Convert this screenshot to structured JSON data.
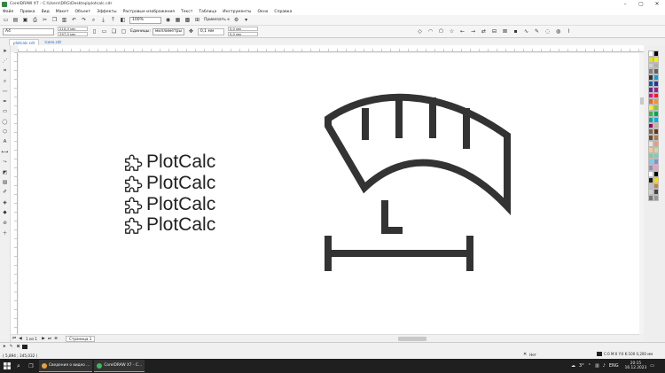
{
  "window": {
    "title": "CorelDRAW X7 - C:\\Users\\DRG\\Desktop\\plotcalc.cdr",
    "controls": {
      "minimize": "–",
      "maximize": "▢",
      "close": "✕"
    }
  },
  "menu": {
    "items": [
      "Файл",
      "Правка",
      "Вид",
      "Макет",
      "Объект",
      "Эффекты",
      "Растровые изображения",
      "Текст",
      "Таблица",
      "Инструменты",
      "Окно",
      "Справка"
    ]
  },
  "toolbar": {
    "zoom": "100%",
    "snap_label": "Привязать к"
  },
  "property_bar": {
    "preset": "A4",
    "width": "210,0 мм",
    "height": "297,0 мм",
    "units_label": "Единицы:",
    "units": "миллиметры",
    "nudge": "0,1 мм",
    "dup_x": "5,0 мм",
    "dup_y": "5,0 мм"
  },
  "doc_tabs": [
    "plotcalc.cdr",
    "icons.cdr"
  ],
  "canvas": {
    "brand_rows": [
      "PlotCalc",
      "PlotCalc",
      "PlotCalc",
      "PlotCalc"
    ]
  },
  "page_nav": {
    "count": "1 из 1",
    "page_tab": "Страница 1"
  },
  "status": {
    "coords": "( 5,894 ; 345,032 )",
    "outline_label": "Нет",
    "fill_label": "C:0 M:0 Y:0 K:100  0,200 мм"
  },
  "taskbar": {
    "apps": [
      {
        "label": "Сведения о видео ...",
        "color": "#e8a33d"
      },
      {
        "label": "CorelDRAW X7 - C...",
        "color": "#3dba5b"
      }
    ],
    "tray": {
      "temp": "3°",
      "lang": "ENG",
      "time": "20:15",
      "date": "16.12.2023"
    }
  },
  "colors": {
    "palette": [
      "#ffffff",
      "#000000",
      "#e6e600",
      "#f2f200",
      "#cfcfcf",
      "#b0b0b0",
      "#808080",
      "#606060",
      "#333333",
      "#00a3e0",
      "#0066b3",
      "#2e3192",
      "#662d91",
      "#92278f",
      "#ec008c",
      "#ed1c24",
      "#f26522",
      "#f7941d",
      "#fff200",
      "#8dc63f",
      "#39b54a",
      "#00a651",
      "#00a99d",
      "#00aeef",
      "#9e005d",
      "#c2b59b",
      "#8c6239",
      "#603913",
      "#754c24",
      "#a67c52",
      "#e5e5e5",
      "#f7977a",
      "#fdc68a",
      "#c4df9b",
      "#82ca9c",
      "#7accc8",
      "#6dcff6",
      "#8393ca",
      "#a187be",
      "#f49ac2",
      "#ffffff",
      "#000000",
      "#1d1d1b",
      "#ffd700",
      "#c0c0c0",
      "#cd7f32",
      "#d0d0d0",
      "#444444",
      "#777777",
      "#999999"
    ]
  }
}
